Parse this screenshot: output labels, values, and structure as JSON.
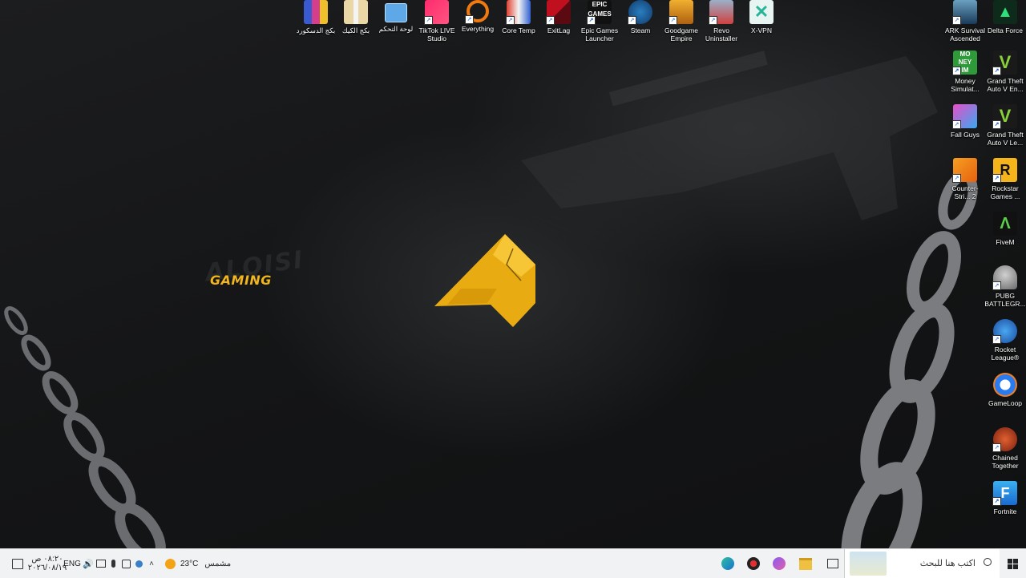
{
  "desktop": {
    "brand": {
      "ghost_text": "ALQISI",
      "accent_text": "GAMING",
      "accent_color": "#f2b51c"
    },
    "top_icons": [
      {
        "label": "بكج الدسكورد",
        "icon": "winrar-icon"
      },
      {
        "label": "بكج الكيك",
        "icon": "winrar-icon"
      },
      {
        "label": "لوحة التحكم",
        "icon": "control-panel-icon"
      },
      {
        "label": "TikTok LIVE Studio",
        "icon": "tiktok-icon"
      },
      {
        "label": "Everything",
        "icon": "search-magnifier-icon"
      },
      {
        "label": "Core Temp",
        "icon": "thermometer-icon"
      },
      {
        "label": "ExitLag",
        "icon": "exitlag-icon"
      },
      {
        "label": "Epic Games Launcher",
        "icon": "epic-games-icon"
      },
      {
        "label": "Steam",
        "icon": "steam-icon"
      },
      {
        "label": "Goodgame Empire",
        "icon": "crown-icon"
      },
      {
        "label": "Revo Uninstaller",
        "icon": "revo-icon"
      },
      {
        "label": "X-VPN",
        "icon": "x-vpn-icon"
      }
    ],
    "right_icons_col1": [
      {
        "label": "ARK Survival Ascended",
        "icon": "ark-icon"
      },
      {
        "label": "Money Simulat...",
        "icon": "money-simulator-icon"
      },
      {
        "label": "Fall Guys",
        "icon": "fall-guys-icon"
      },
      {
        "label": "Counter-Stri... 2",
        "icon": "counter-strike-icon"
      }
    ],
    "right_icons_col2": [
      {
        "label": "Delta Force",
        "icon": "delta-force-icon"
      },
      {
        "label": "Grand Theft Auto V En...",
        "icon": "gta-v-icon"
      },
      {
        "label": "Grand Theft Auto V Le...",
        "icon": "gta-v-icon"
      },
      {
        "label": "Rockstar Games ...",
        "icon": "rockstar-icon"
      },
      {
        "label": "FiveM",
        "icon": "fivem-icon"
      },
      {
        "label": "PUBG BATTLEGR...",
        "icon": "pubg-icon"
      },
      {
        "label": "Rocket League®",
        "icon": "rocket-league-icon"
      },
      {
        "label": "GameLoop",
        "icon": "gameloop-icon"
      },
      {
        "label": "Chained Together",
        "icon": "chained-together-icon"
      },
      {
        "label": "Fortnite",
        "icon": "fortnite-icon"
      }
    ]
  },
  "taskbar": {
    "time": "٠٨:٢٠ ص",
    "date": "٢٠٢٦/٠٨/١٩",
    "language": "ENG",
    "weather_temp": "23°C",
    "weather_text": "مشمس",
    "search_placeholder": "اكتب هنا للبحث",
    "pinned": [
      "edge-icon",
      "app-red-icon",
      "discord-icon",
      "file-explorer-icon",
      "task-view-icon"
    ]
  },
  "colors": {
    "taskbar_bg": "#f1f2f3",
    "logo_gold": "#f2b51c"
  }
}
